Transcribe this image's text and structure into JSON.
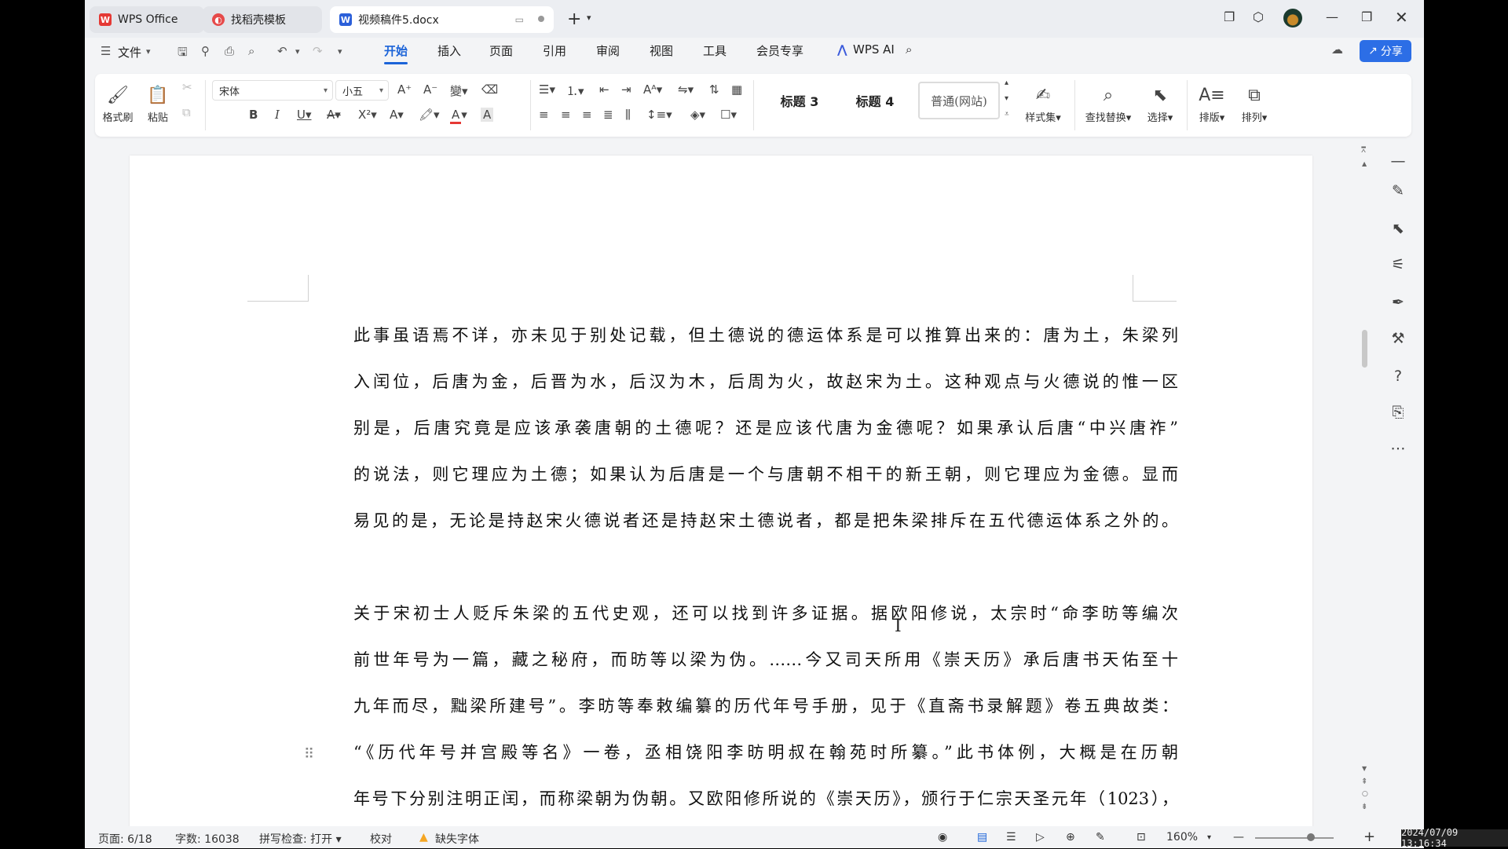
{
  "tabs": [
    {
      "label": "WPS Office",
      "icon": "wps-logo-icon",
      "color": "#e53935"
    },
    {
      "label": "找稻壳模板",
      "icon": "docer-icon",
      "color": "#e64a4a"
    },
    {
      "label": "视频稿件5.docx",
      "icon": "word-doc-icon",
      "color": "#2b5fd9"
    }
  ],
  "menu": {
    "file": "文件",
    "items": [
      "开始",
      "插入",
      "页面",
      "引用",
      "审阅",
      "视图",
      "工具",
      "会员专享"
    ],
    "active": "开始",
    "ai": "WPS AI",
    "share": "分享"
  },
  "ribbon": {
    "format_painter": "格式刷",
    "paste": "粘贴",
    "font_name": "宋体",
    "font_size": "小五",
    "styles": [
      "标题 3",
      "标题 4",
      "普通(网站)"
    ],
    "style_set": "样式集",
    "find_replace": "查找替换",
    "select": "选择",
    "layout": "排版",
    "arrange": "排列"
  },
  "document": {
    "paragraph1": [
      "此事虽语焉不详，亦未见于别处记载，但土德说的德运体系是可以推算出来的：唐为土，朱梁列",
      "入闰位，后唐为金，后晋为水，后汉为木，后周为火，故赵宋为土。这种观点与火德说的惟一区",
      "别是，后唐究竟是应该承袭唐朝的土德呢？还是应该代唐为金德呢？如果承认后唐“中兴唐祚”",
      "的说法，则它理应为土德；如果认为后唐是一个与唐朝不相干的新王朝，则它理应为金德。显而",
      "易见的是，无论是持赵宋火德说者还是持赵宋土德说者，都是把朱梁排斥在五代德运体系之外的。"
    ],
    "paragraph2": [
      "关于宋初士人贬斥朱梁的五代史观，还可以找到许多证据。据欧阳修说，太宗时“命李昉等编次",
      "前世年号为一篇，藏之秘府，而昉等以梁为伪。……今又司天所用《崇天历》承后唐书天佑至十",
      "九年而尽，黜梁所建号”。李昉等奉敕编纂的历代年号手册，见于《直斋书录解题》卷五典故类：",
      "“《历代年号并宫殿等名》一卷，丞相饶阳李昉明叔在翰苑时所纂。”此书体例，大概是在历朝",
      "年号下分别注明正闰，而称梁朝为伪朝。又欧阳修所说的《崇天历》，颁行于仁宗天圣元年（1023），"
    ]
  },
  "status": {
    "page": "页面: 6/18",
    "words": "字数: 16038",
    "spell": "拼写检查: 打开",
    "proof": "校对",
    "missing_font": "缺失字体",
    "zoom": "160%",
    "zoom_fraction": 0.6
  },
  "clock": "2024/07/09 13:16:34",
  "colors": {
    "accent": "#1b63d8",
    "share_button": "#2c6ee6",
    "warning": "#f5a623"
  }
}
